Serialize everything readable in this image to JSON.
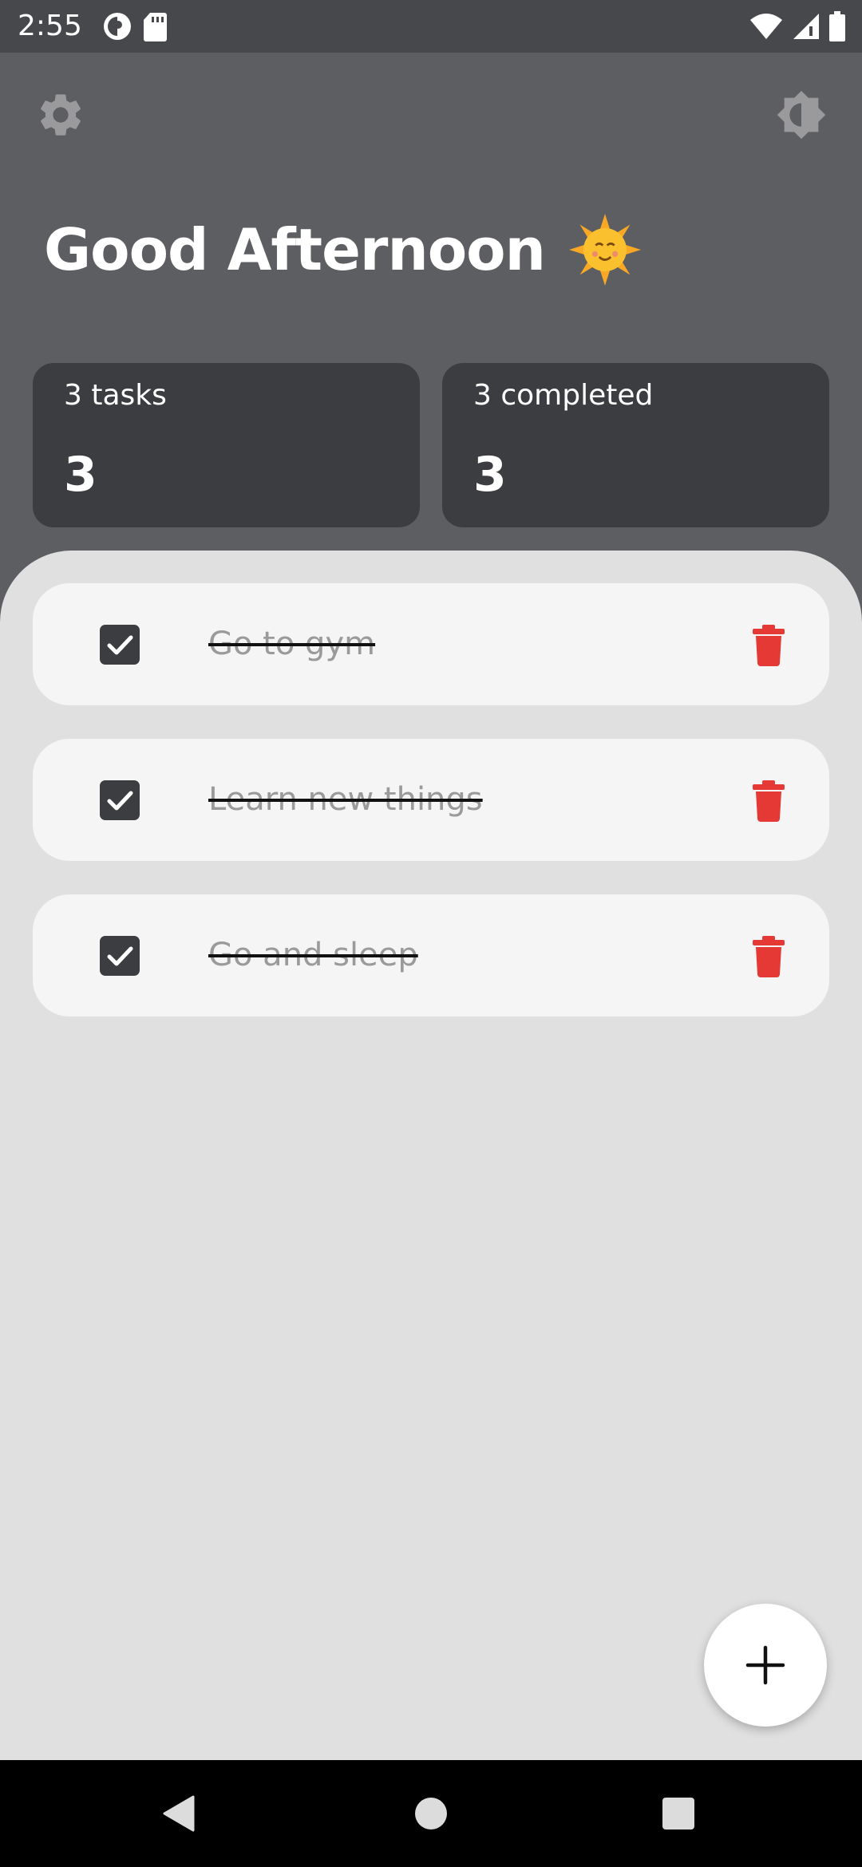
{
  "status_bar": {
    "time": "2:55",
    "left_icons": [
      "data-saver-icon",
      "sd-card-icon"
    ],
    "right_icons": [
      "wifi-icon",
      "cellular-signal-icon",
      "battery-icon"
    ]
  },
  "app_bar": {
    "settings_icon": "gear-icon",
    "theme_icon": "brightness-icon"
  },
  "greeting": {
    "text": "Good Afternoon",
    "emoji": "sun-with-face"
  },
  "stats": {
    "tasks": {
      "label": "3 tasks",
      "value": "3"
    },
    "completed": {
      "label": "3 completed",
      "value": "3"
    }
  },
  "tasks": [
    {
      "title": "Go to gym",
      "completed": true
    },
    {
      "title": "Learn new things",
      "completed": true
    },
    {
      "title": "Go and sleep",
      "completed": true
    }
  ],
  "fab": {
    "icon": "plus-icon"
  },
  "nav_bar": {
    "icons": [
      "back-icon",
      "home-icon",
      "recents-icon"
    ]
  },
  "colors": {
    "header_bg": "#5d5e62",
    "card_bg": "#3c3d40",
    "sheet_bg": "#e0e0e0",
    "task_bg": "#f5f5f5",
    "delete": "#e53935"
  }
}
